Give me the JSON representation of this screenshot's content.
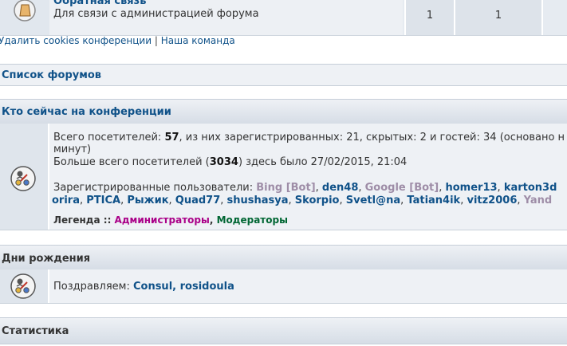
{
  "forum_row": {
    "title": "Обратная связь",
    "description": "Для связи с администрацией форума",
    "topics": "1",
    "posts": "1"
  },
  "footer_links": {
    "delete_cookies": "Удалить cookies конференции",
    "separator": "|",
    "team": "Наша команда"
  },
  "forum_list": {
    "label": "Список форумов"
  },
  "who_is_online": {
    "title": "Кто сейчас на конференции",
    "line1_prefix": "Всего посетителей: ",
    "total": "57",
    "line1_suffix": ", из них зарегистрированных: 21, скрытых: 2 и гостей: 34 (основано н",
    "line2": "минут)",
    "line3_prefix": "Больше всего посетителей (",
    "record": "3034",
    "line3_suffix": ") здесь было 27/02/2015, 21:04",
    "registered_label": "Зарегистрированные пользователи: ",
    "users_line1": [
      {
        "name": "Bing [Bot]",
        "kind": "bot"
      },
      {
        "name": "den48",
        "kind": "user"
      },
      {
        "name": "Google [Bot]",
        "kind": "bot"
      },
      {
        "name": "homer13",
        "kind": "user"
      },
      {
        "name": "karton3d",
        "kind": "user"
      }
    ],
    "users_line2": [
      {
        "name": "orira",
        "kind": "user"
      },
      {
        "name": "PTICA",
        "kind": "user"
      },
      {
        "name": "Рыжик",
        "kind": "user"
      },
      {
        "name": "Quad77",
        "kind": "user"
      },
      {
        "name": "shushasya",
        "kind": "user"
      },
      {
        "name": "Skorpio",
        "kind": "user"
      },
      {
        "name": "Svetl@na",
        "kind": "user"
      },
      {
        "name": "Tatian4ik",
        "kind": "user"
      },
      {
        "name": "vitz2006",
        "kind": "user"
      },
      {
        "name": "Yand",
        "kind": "bot"
      }
    ],
    "legend_label": "Легенда :: ",
    "legend_admins": "Администраторы",
    "legend_sep": ", ",
    "legend_mods": "Модераторы"
  },
  "birthdays": {
    "title": "Дни рождения",
    "prefix": "Поздравляем: ",
    "names": "Consul, rosidoula"
  },
  "statistics": {
    "title": "Статистика"
  },
  "colors": {
    "link": "#105289",
    "bot": "#9e8da7",
    "admin": "#aa0088",
    "moderator": "#00aa00"
  }
}
